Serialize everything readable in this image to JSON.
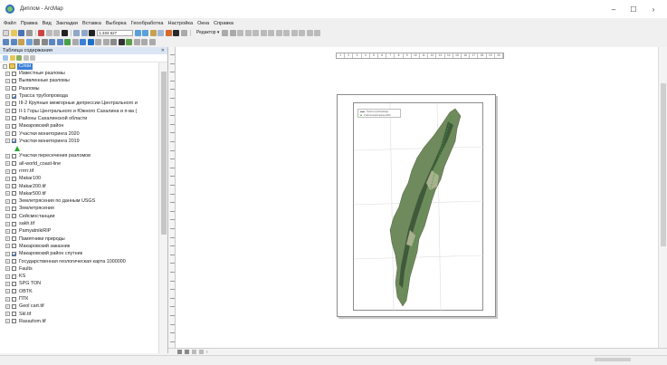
{
  "window": {
    "title": "Диплом - ArcMap",
    "controls": [
      "–",
      "☐",
      "›"
    ]
  },
  "menubar": {
    "items": [
      "Файл",
      "Правка",
      "Вид",
      "Закладки",
      "Вставка",
      "Выборка",
      "Геообработка",
      "Настройка",
      "Окна",
      "Справка"
    ]
  },
  "toolbar": {
    "scale_value": "1:404 627",
    "editor_label": "Редактор ▾"
  },
  "toc": {
    "title": "Таблица содержания",
    "close_glyph": "✕",
    "root_label": "Слои",
    "layers": [
      {
        "label": "Известные разломы",
        "checked": false
      },
      {
        "label": "Выявленные разломы",
        "checked": false
      },
      {
        "label": "Разломы",
        "checked": false
      },
      {
        "label": "Трасса трубопровода",
        "checked": true
      },
      {
        "label": "III-2 Крупные межгорные депрессии Центрального и",
        "checked": false
      },
      {
        "label": "II-1 Горы Центрального и Южного Сахалина и п-ва (",
        "checked": false
      },
      {
        "label": "Районы Сахалинской области",
        "checked": false
      },
      {
        "label": "Макаровский район",
        "checked": false
      },
      {
        "label": "Участки мониторинга 2020",
        "checked": false
      },
      {
        "label": "Участки мониторинга 2019",
        "checked": true
      },
      {
        "label": "Участки пересечения разломов",
        "checked": false
      },
      {
        "label": "all-world_coast-line",
        "checked": false
      },
      {
        "label": "rrrrrr.tif",
        "checked": false
      },
      {
        "label": "Makar100",
        "checked": false
      },
      {
        "label": "Makar200.tif",
        "checked": false
      },
      {
        "label": "Makar500.tif",
        "checked": false
      },
      {
        "label": "Землетрясения по данным USGS",
        "checked": false
      },
      {
        "label": "Землетрясения",
        "checked": false
      },
      {
        "label": "Сейсмостанции",
        "checked": false
      },
      {
        "label": "sakh.tif",
        "checked": false
      },
      {
        "label": "PamyatnikiRIP",
        "checked": false
      },
      {
        "label": "Памятники природы",
        "checked": false
      },
      {
        "label": "Макаровский заказник",
        "checked": false
      },
      {
        "label": "Макаровский район спутник",
        "checked": true
      },
      {
        "label": "Государственная геологическая карта 1000000",
        "checked": false
      },
      {
        "label": "Faults",
        "checked": false
      },
      {
        "label": "KS",
        "checked": false
      },
      {
        "label": "SPG TON",
        "checked": false
      },
      {
        "label": "OBTK",
        "checked": false
      },
      {
        "label": "ПТК",
        "checked": false
      },
      {
        "label": "Geol cart.tif",
        "checked": false
      },
      {
        "label": "Skl.tif",
        "checked": false
      },
      {
        "label": "Rasazlom.tif",
        "checked": false
      }
    ]
  },
  "ruler": {
    "labels": [
      "1",
      "2",
      "3",
      "4",
      "5",
      "6",
      "7",
      "8",
      "9",
      "10",
      "11",
      "12",
      "13",
      "14",
      "15",
      "16",
      "17",
      "18",
      "19",
      "20"
    ]
  },
  "colors": {
    "accent": "#3c7fd6",
    "legend_symbol": "#2aa830",
    "island_dark": "#3f5a3a",
    "island_mid": "#6f8a5c",
    "island_light": "#a9b08e"
  }
}
